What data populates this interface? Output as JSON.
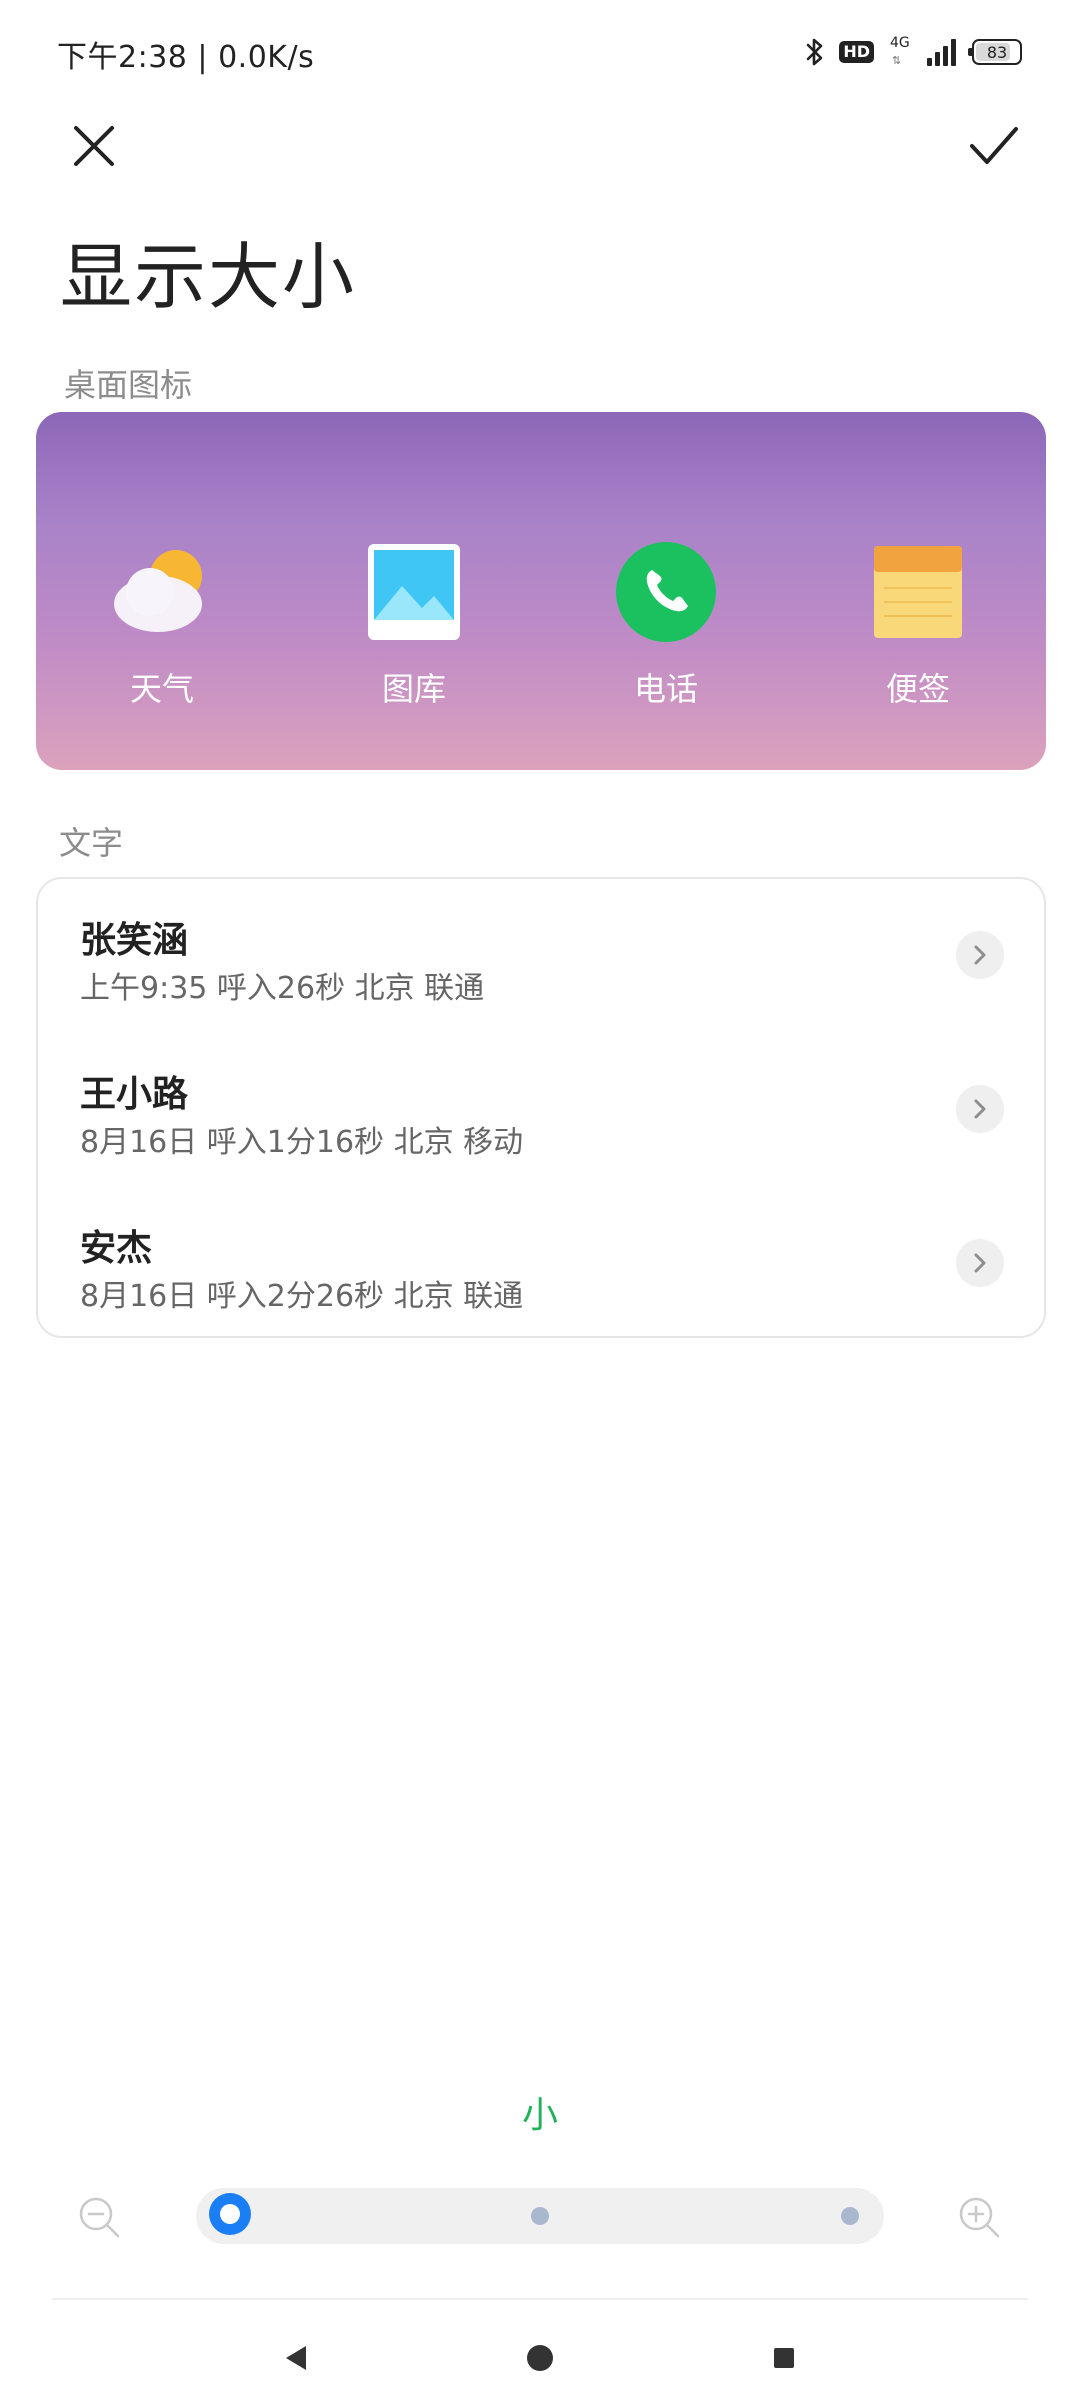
{
  "status_bar": {
    "time": "下午2:38",
    "separator": "|",
    "net_speed": "0.0K/s",
    "hd": "HD",
    "network_type": "4G",
    "battery_level": "83",
    "icons": [
      "bluetooth-icon",
      "hd-voice-icon",
      "network-4g-icon",
      "signal-icon",
      "battery-icon"
    ]
  },
  "header": {
    "close_icon": "close-icon",
    "confirm_icon": "check-icon",
    "title": "显示大小"
  },
  "icon_section": {
    "label": "桌面图标",
    "apps": [
      {
        "label": "天气",
        "icon": "weather-icon"
      },
      {
        "label": "图库",
        "icon": "gallery-icon"
      },
      {
        "label": "电话",
        "icon": "phone-icon"
      },
      {
        "label": "便签",
        "icon": "notes-icon"
      }
    ]
  },
  "text_section": {
    "label": "文字",
    "calls": [
      {
        "name": "张笑涵",
        "detail": "上午9:35 呼入26秒 北京 联通"
      },
      {
        "name": "王小路",
        "detail": "8月16日 呼入1分16秒 北京 移动"
      },
      {
        "name": "安杰",
        "detail": "8月16日 呼入2分26秒 北京 联通"
      }
    ]
  },
  "size_selector": {
    "current_label": "小",
    "levels": 3,
    "selected_index": 0,
    "accent_color": "#21b15a",
    "thumb_color": "#1a7ff5"
  },
  "nav_bar": {
    "icons": [
      "back-icon",
      "home-icon",
      "recents-icon"
    ]
  }
}
